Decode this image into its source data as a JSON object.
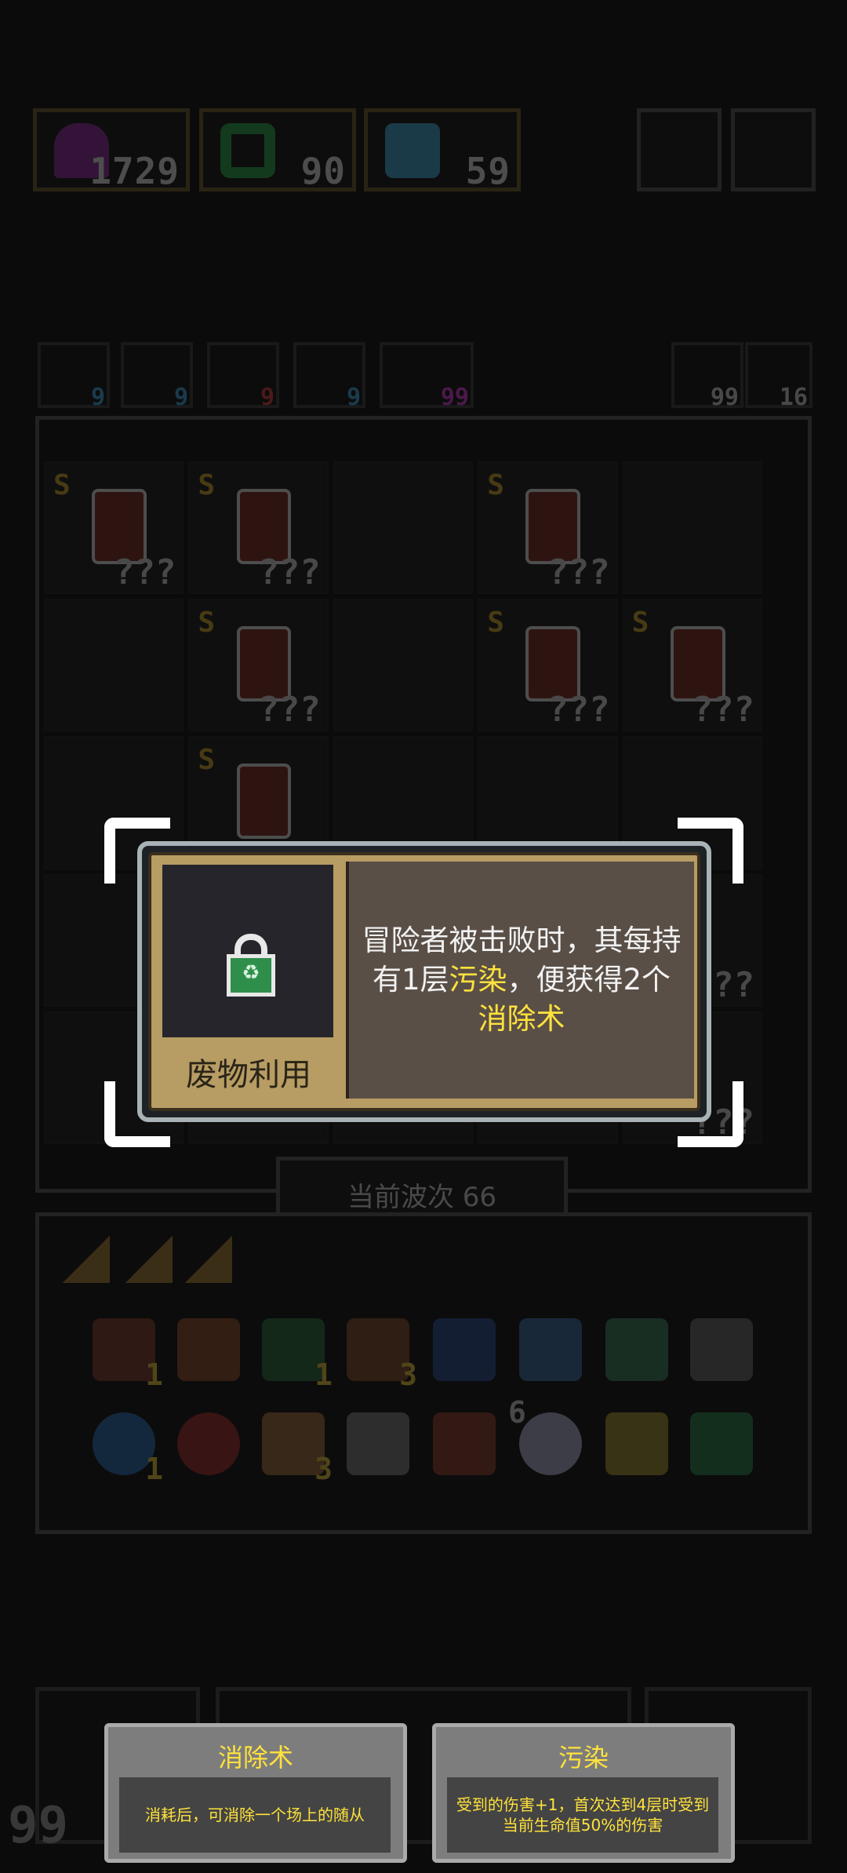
{
  "currencies": [
    {
      "name": "purple-gem-icon",
      "value": "1729"
    },
    {
      "name": "green-token-icon",
      "value": "90"
    },
    {
      "name": "hero-portrait-icon",
      "value": "59"
    }
  ],
  "status_icons": [
    {
      "name": "target-icon",
      "value": "9",
      "color": "#3fa0d8"
    },
    {
      "name": "lightning-icon",
      "value": "9",
      "color": "#3fa0d8"
    },
    {
      "name": "gear-icon",
      "value": "9",
      "color": "#d23a3a"
    },
    {
      "name": "eye-icon",
      "value": "9",
      "color": "#3fa0d8"
    },
    {
      "name": "magnet-icon",
      "value": "99",
      "color": "#d23ad2"
    }
  ],
  "right_counters": [
    {
      "name": "refresh-icon",
      "value": "99"
    },
    {
      "name": "bolt-icon",
      "value": "16"
    }
  ],
  "board": {
    "rank_label": "S",
    "unknown_label": "???",
    "wave_label": "当前波次 66"
  },
  "popup": {
    "name": "废物利用",
    "icon": "recycle-lock-icon",
    "desc_part1": "冒险者被击败时，其每持有1层",
    "kw1": "污染",
    "desc_part2": "，便获得2个",
    "kw2": "消除术"
  },
  "inventory_counts": [
    "1",
    "1",
    "3",
    "1",
    "3",
    "6"
  ],
  "corner_number": "99",
  "tooltips": [
    {
      "title": "消除术",
      "desc": "消耗后，可消除一个场上的随从"
    },
    {
      "title": "污染",
      "desc": "受到的伤害+1，首次达到4层时受到当前生命值50%的伤害"
    }
  ]
}
